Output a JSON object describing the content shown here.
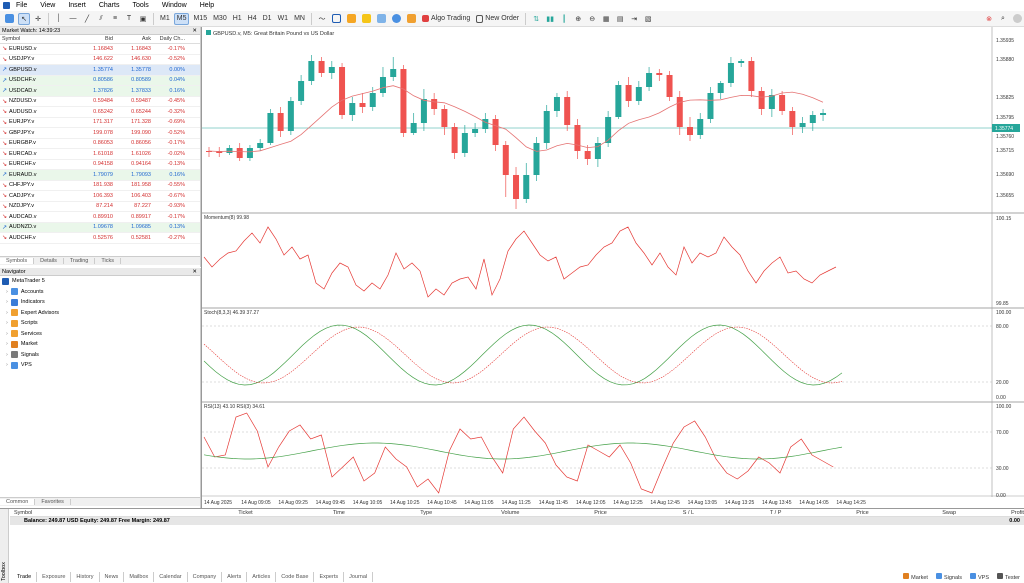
{
  "menu": [
    "File",
    "View",
    "Insert",
    "Charts",
    "Tools",
    "Window",
    "Help"
  ],
  "toolbar": {
    "timeframes": [
      "M1",
      "M5",
      "M15",
      "M30",
      "H1",
      "H4",
      "D1",
      "W1",
      "MN"
    ],
    "active_tf": "M5",
    "algo": "Algo Trading",
    "new_order": "New Order"
  },
  "market_watch": {
    "title": "Market Watch: 14:39:23",
    "cols": [
      "Symbol",
      "Bid",
      "Ask",
      "Daily Ch..."
    ],
    "rows": [
      [
        "EURUSD.v",
        "1.16843",
        "1.16843",
        "-0.17%"
      ],
      [
        "USDJPY.v",
        "146.622",
        "146.630",
        "-0.52%"
      ],
      [
        "GBPUSD.v",
        "1.35774",
        "1.35778",
        "0.00%"
      ],
      [
        "USDCHF.v",
        "0.80586",
        "0.80589",
        "0.04%"
      ],
      [
        "USDCAD.v",
        "1.37826",
        "1.37833",
        "0.16%"
      ],
      [
        "NZDUSD.v",
        "0.59484",
        "0.59487",
        "-0.45%"
      ],
      [
        "AUDUSD.v",
        "0.65242",
        "0.65244",
        "-0.32%"
      ],
      [
        "EURJPY.v",
        "171.317",
        "171.328",
        "-0.69%"
      ],
      [
        "GBPJPY.v",
        "199.078",
        "199.090",
        "-0.52%"
      ],
      [
        "EURGBP.v",
        "0.86053",
        "0.86056",
        "-0.17%"
      ],
      [
        "EURCAD.v",
        "1.61018",
        "1.61026",
        "-0.02%"
      ],
      [
        "EURCHF.v",
        "0.94158",
        "0.94164",
        "-0.13%"
      ],
      [
        "EURAUD.v",
        "1.79079",
        "1.79093",
        "0.16%"
      ],
      [
        "CHFJPY.v",
        "181.938",
        "181.958",
        "-0.55%"
      ],
      [
        "CADJPY.v",
        "106.393",
        "106.403",
        "-0.67%"
      ],
      [
        "NZDJPY.v",
        "87.214",
        "87.227",
        "-0.93%"
      ],
      [
        "AUDCAD.v",
        "0.89910",
        "0.89917",
        "-0.17%"
      ],
      [
        "AUDNZD.v",
        "1.09678",
        "1.09685",
        "0.13%"
      ],
      [
        "AUDCHF.v",
        "0.52576",
        "0.52581",
        "-0.27%"
      ]
    ],
    "tabs": [
      "Symbols",
      "Details",
      "Trading",
      "Ticks"
    ]
  },
  "navigator": {
    "title": "Navigator",
    "root": "MetaTrader 5",
    "items": [
      "Accounts",
      "Indicators",
      "Expert Advisors",
      "Scripts",
      "Services",
      "Market",
      "Signals",
      "VPS"
    ],
    "tabs": [
      "Common",
      "Favorites"
    ]
  },
  "chart": {
    "title": "GBPUSD.v, M5:  Great Britain Pound vs US Dollar",
    "price_ticks": [
      "1.35935",
      "1.35880",
      "1.35825",
      "1.35795",
      "1.35760",
      "1.35715",
      "1.35690",
      "1.35655"
    ],
    "current_price": "1.35774",
    "momentum_label": "Momentum(8) 99.98",
    "momentum_ticks": [
      "100.15",
      "99.85"
    ],
    "stoch_label": "Stoch(8,3,3) 46.39 37.27",
    "stoch_ticks": [
      "100.00",
      "80.00",
      "20.00",
      "0.00"
    ],
    "rsi_label": "RSI(13) 43.10 RSI(3) 34.61",
    "rsi_ticks": [
      "100.00",
      "70.00",
      "30.00",
      "0.00"
    ],
    "time_ticks": [
      "14 Aug 2025",
      "14 Aug 09:05",
      "14 Aug 09:25",
      "14 Aug 09:45",
      "14 Aug 10:05",
      "14 Aug 10:25",
      "14 Aug 10:45",
      "14 Aug 11:05",
      "14 Aug 11:25",
      "14 Aug 11:45",
      "14 Aug 12:05",
      "14 Aug 12:25",
      "14 Aug 12:45",
      "14 Aug 13:05",
      "14 Aug 13:25",
      "14 Aug 13:45",
      "14 Aug 14:05",
      "14 Aug 14:25"
    ]
  },
  "toolbox": {
    "cols": [
      "Symbol",
      "Ticket",
      "Time",
      "Type",
      "Volume",
      "Price",
      "S / L",
      "T / P",
      "Price",
      "Swap",
      "Profit"
    ],
    "balance": "Balance: 249.87 USD  Equity: 249.87  Free Margin: 249.87",
    "profit": "0.00",
    "tabs": [
      "Trade",
      "Exposure",
      "History",
      "News",
      "Mailbox",
      "Calendar",
      "Company",
      "Alerts",
      "Articles",
      "Code Base",
      "Experts",
      "Journal"
    ],
    "side": "Toolbox"
  },
  "status": [
    "Market",
    "Signals",
    "VPS",
    "Tester"
  ],
  "colors": {
    "bull": "#26a69a",
    "bear": "#ef5350",
    "accent": "#1e5cb3"
  }
}
